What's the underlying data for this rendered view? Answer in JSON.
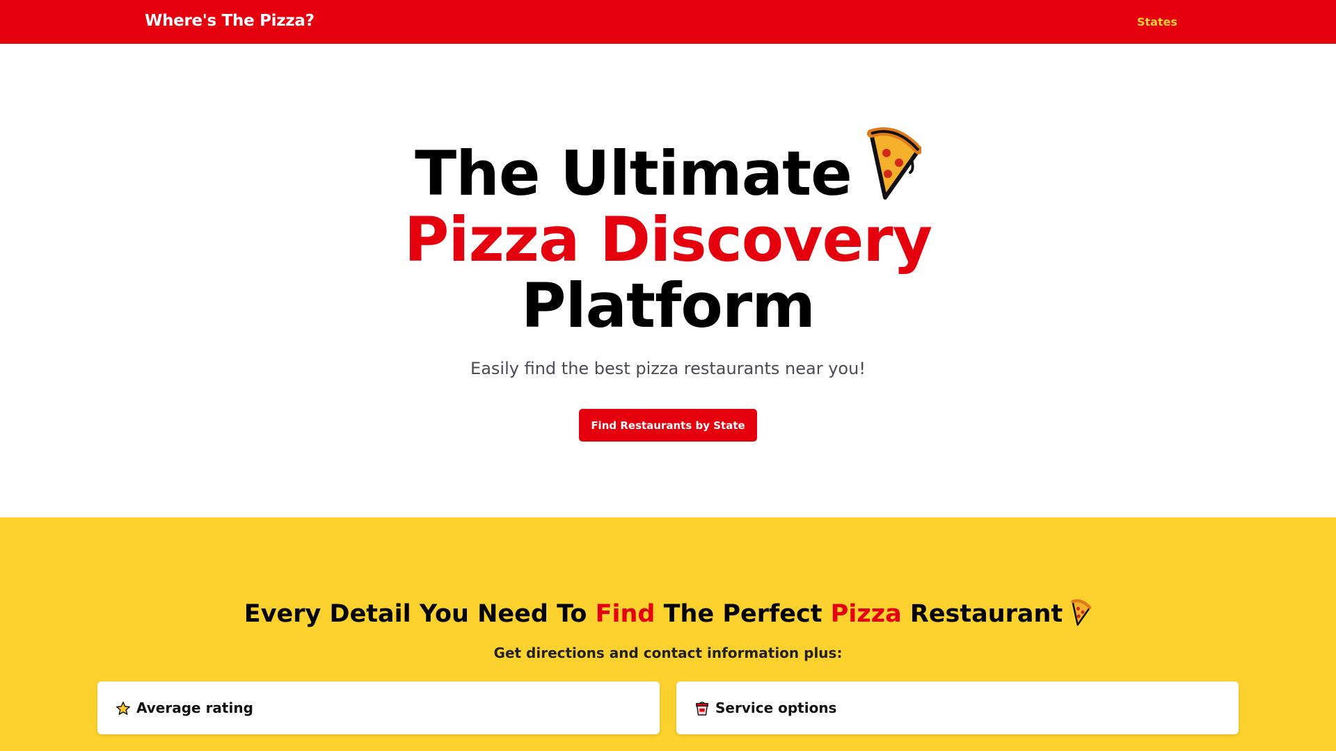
{
  "colors": {
    "brand_red": "#e5000d",
    "brand_yellow": "#fed22e",
    "nav_link": "#ffd22e"
  },
  "navbar": {
    "brand": "Where's The Pizza?",
    "link_states": "States"
  },
  "hero": {
    "title_line1": "The Ultimate",
    "title_line2": "Pizza Discovery",
    "title_line3": "Platform",
    "icon": "pizza-slice-icon",
    "subtitle": "Easily find the best pizza restaurants near you!",
    "cta": "Find Restaurants by State"
  },
  "features": {
    "title_part1": "Every Detail You Need To ",
    "title_find": "Find",
    "title_part2": " The Perfect ",
    "title_pizza": "Pizza",
    "title_part3": " Restaurant",
    "title_icon": "pizza-slice-icon",
    "subtitle": "Get directions and contact information plus:",
    "cards": [
      {
        "icon": "star-icon",
        "label": "Average rating"
      },
      {
        "icon": "takeout-box-icon",
        "label": "Service options"
      }
    ]
  }
}
